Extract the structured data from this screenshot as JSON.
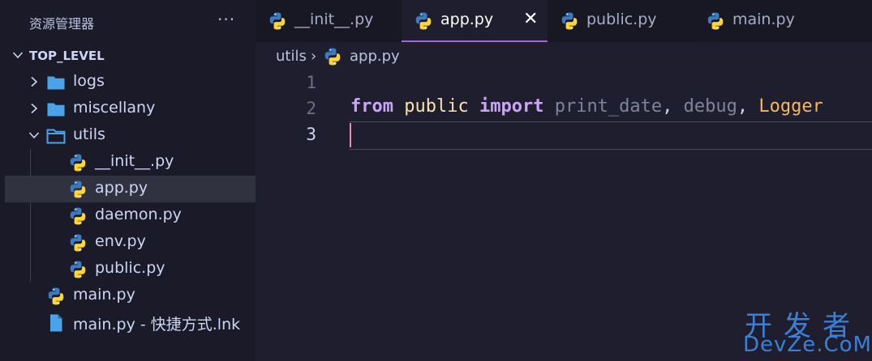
{
  "explorer": {
    "title": "资源管理器",
    "more": "···",
    "root": "TOP_LEVEL",
    "items": [
      {
        "label": "logs"
      },
      {
        "label": "miscellany"
      },
      {
        "label": "utils"
      },
      {
        "label": "__init__.py"
      },
      {
        "label": "app.py"
      },
      {
        "label": "daemon.py"
      },
      {
        "label": "env.py"
      },
      {
        "label": "public.py"
      },
      {
        "label": "main.py"
      },
      {
        "label": "main.py - 快捷方式.lnk"
      }
    ]
  },
  "tabs": [
    {
      "label": "__init__.py"
    },
    {
      "label": "app.py",
      "close": "✕"
    },
    {
      "label": "public.py"
    },
    {
      "label": "main.py"
    }
  ],
  "breadcrumb": {
    "folder": "utils",
    "sep": "›",
    "file": "app.py"
  },
  "editor": {
    "line_numbers": [
      "1",
      "2",
      "3"
    ],
    "line2": {
      "kw1": "from",
      "module": "public",
      "kw2": "import",
      "n1": "print_date",
      "c1": ",",
      "n2": "debug",
      "c2": ",",
      "n3": "Logger"
    }
  },
  "watermark": {
    "cn": "开发者",
    "en": "DevZe.CoM"
  },
  "colors": {
    "accent": "#a06ad6",
    "folder": "#4aa3e8",
    "python_blue": "#3572a5",
    "python_yellow": "#ffd43b"
  },
  "icons": [
    "chevron-right-icon",
    "chevron-down-icon",
    "folder-icon",
    "folder-open-icon",
    "python-file-icon",
    "file-icon",
    "close-icon",
    "more-icon"
  ]
}
